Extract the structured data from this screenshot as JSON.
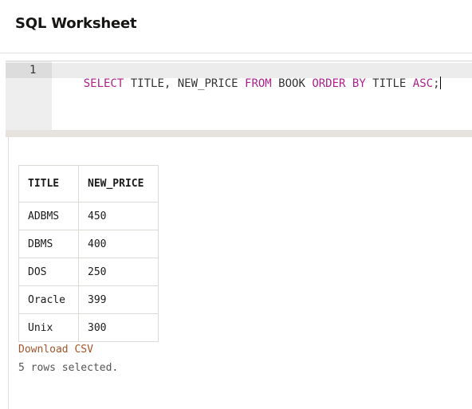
{
  "header": {
    "title": "SQL Worksheet"
  },
  "editor": {
    "line_number": "1",
    "tokens": [
      {
        "text": "SELECT",
        "kw": true
      },
      {
        "text": " TITLE, NEW_PRICE ",
        "kw": false
      },
      {
        "text": "FROM",
        "kw": true
      },
      {
        "text": " BOOK ",
        "kw": false
      },
      {
        "text": "ORDER BY",
        "kw": true
      },
      {
        "text": " TITLE ",
        "kw": false
      },
      {
        "text": "ASC",
        "kw": true
      },
      {
        "text": ";",
        "kw": false
      }
    ]
  },
  "results": {
    "columns": [
      "TITLE",
      "NEW_PRICE"
    ],
    "rows": [
      [
        "ADBMS",
        "450"
      ],
      [
        "DBMS",
        "400"
      ],
      [
        "DOS",
        "250"
      ],
      [
        "Oracle",
        "399"
      ],
      [
        "Unix",
        "300"
      ]
    ],
    "download_label": "Download CSV",
    "row_count_text": "5 rows selected."
  },
  "colors": {
    "keyword": "#b01f8e",
    "link": "#a0552a"
  }
}
